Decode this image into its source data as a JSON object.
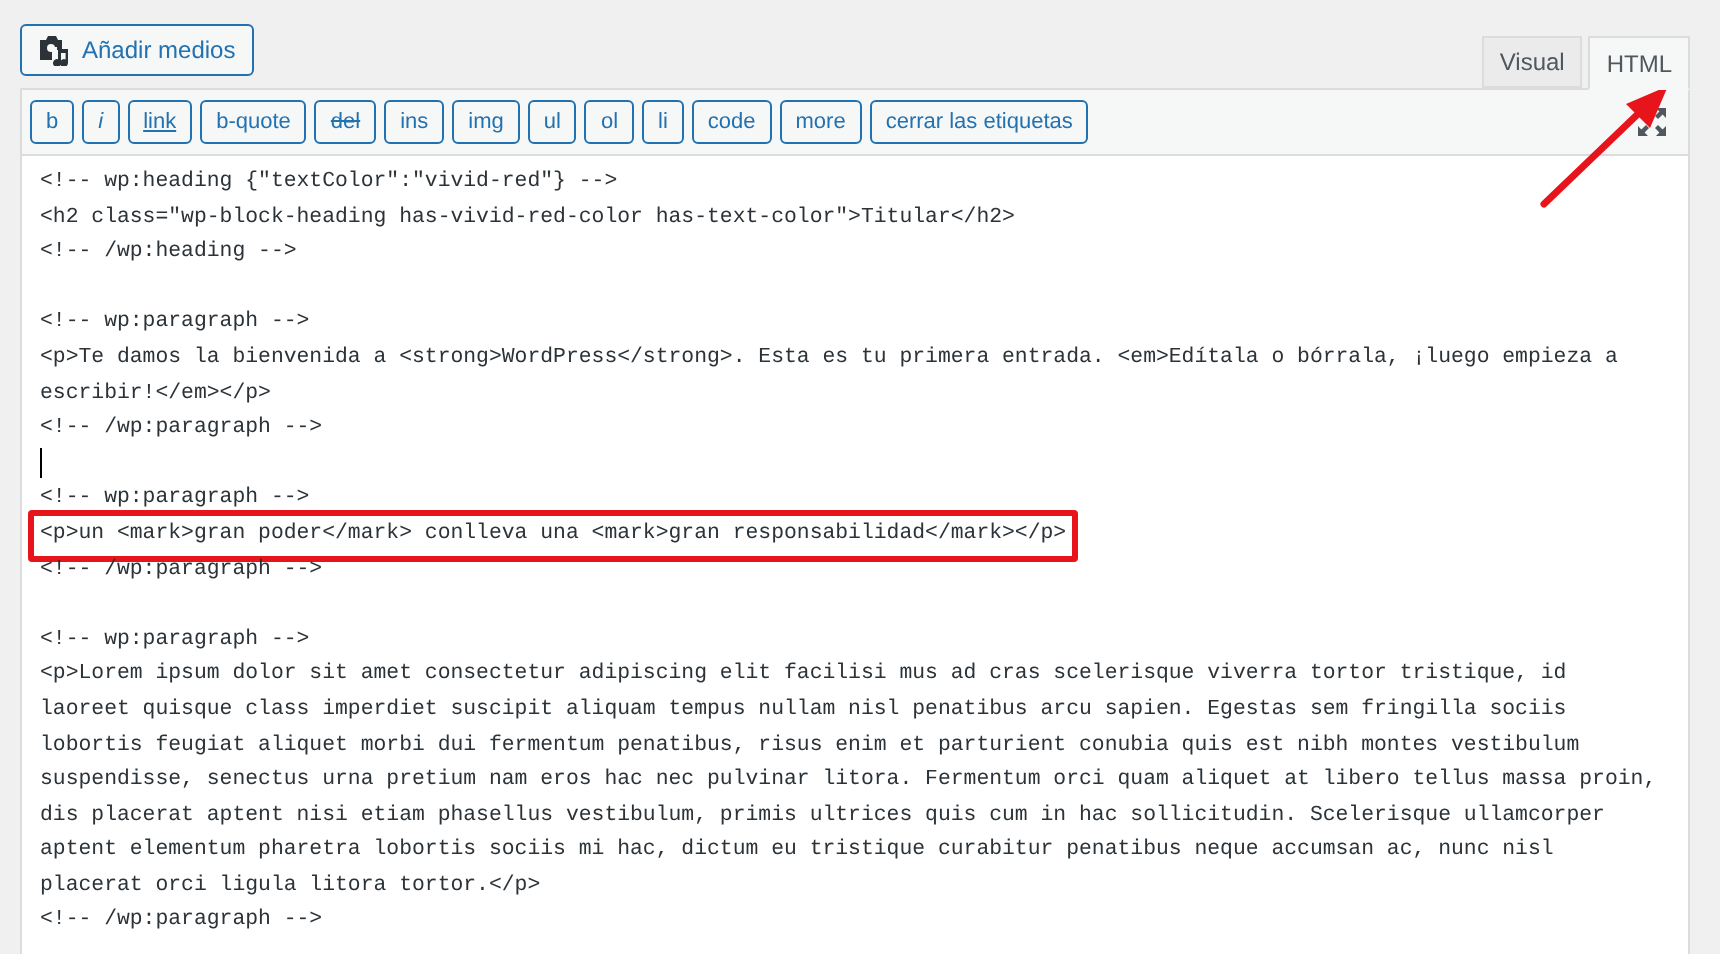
{
  "media_button": {
    "label": "Añadir medios"
  },
  "tabs": [
    {
      "label": "Visual",
      "selected": false
    },
    {
      "label": "HTML",
      "selected": true
    }
  ],
  "toolbar": [
    {
      "label": "b",
      "kind": "plain"
    },
    {
      "label": "i",
      "kind": "italic"
    },
    {
      "label": "link",
      "kind": "underline"
    },
    {
      "label": "b-quote",
      "kind": "plain"
    },
    {
      "label": "del",
      "kind": "strike"
    },
    {
      "label": "ins",
      "kind": "plain"
    },
    {
      "label": "img",
      "kind": "plain"
    },
    {
      "label": "ul",
      "kind": "plain"
    },
    {
      "label": "ol",
      "kind": "plain"
    },
    {
      "label": "li",
      "kind": "plain"
    },
    {
      "label": "code",
      "kind": "plain"
    },
    {
      "label": "more",
      "kind": "plain"
    },
    {
      "label": "cerrar las etiquetas",
      "kind": "plain"
    }
  ],
  "lines": [
    {
      "kind": "code",
      "text": "<!-- wp:heading {\"textColor\":\"vivid-red\"} -->",
      "highlighted": false
    },
    {
      "kind": "code",
      "text": "<h2 class=\"wp-block-heading has-vivid-red-color has-text-color\">Titular</h2>",
      "highlighted": false
    },
    {
      "kind": "code",
      "text": "<!-- /wp:heading -->",
      "highlighted": false
    },
    {
      "kind": "blank"
    },
    {
      "kind": "code",
      "text": "<!-- wp:paragraph -->",
      "highlighted": false
    },
    {
      "kind": "code",
      "text": "<p>Te damos la bienvenida a <strong>WordPress</strong>. Esta es tu primera entrada. <em>Edítala o bórrala, ¡luego empieza a",
      "highlighted": false
    },
    {
      "kind": "code",
      "text": "escribir!</em></p>",
      "highlighted": false
    },
    {
      "kind": "code",
      "text": "<!-- /wp:paragraph -->",
      "highlighted": false
    },
    {
      "kind": "cursor"
    },
    {
      "kind": "code",
      "text": "<!-- wp:paragraph -->",
      "highlighted": false
    },
    {
      "kind": "code",
      "text": "<p>un <mark>gran poder</mark> conlleva una <mark>gran responsabilidad</mark></p>",
      "highlighted": true
    },
    {
      "kind": "code",
      "text": "<!-- /wp:paragraph -->",
      "highlighted": false
    },
    {
      "kind": "blank"
    },
    {
      "kind": "code",
      "text": "<!-- wp:paragraph -->",
      "highlighted": false
    },
    {
      "kind": "code",
      "text": "<p>Lorem ipsum dolor sit amet consectetur adipiscing elit facilisi mus ad cras scelerisque viverra tortor tristique, id",
      "highlighted": false
    },
    {
      "kind": "code",
      "text": "laoreet quisque class imperdiet suscipit aliquam tempus nullam nisl penatibus arcu sapien. Egestas sem fringilla sociis",
      "highlighted": false
    },
    {
      "kind": "code",
      "text": "lobortis feugiat aliquet morbi dui fermentum penatibus, risus enim et parturient conubia quis est nibh montes vestibulum",
      "highlighted": false
    },
    {
      "kind": "code",
      "text": "suspendisse, senectus urna pretium nam eros hac nec pulvinar litora. Fermentum orci quam aliquet at libero tellus massa proin,",
      "highlighted": false
    },
    {
      "kind": "code",
      "text": "dis placerat aptent nisi etiam phasellus vestibulum, primis ultrices quis cum in hac sollicitudin. Scelerisque ullamcorper",
      "highlighted": false
    },
    {
      "kind": "code",
      "text": "aptent elementum pharetra lobortis sociis mi hac, dictum eu tristique curabitur penatibus neque accumsan ac, nunc nisl",
      "highlighted": false
    },
    {
      "kind": "code",
      "text": "placerat orci ligula litora tortor.</p>",
      "highlighted": false
    },
    {
      "kind": "code",
      "text": "<!-- /wp:paragraph -->",
      "highlighted": false
    }
  ]
}
